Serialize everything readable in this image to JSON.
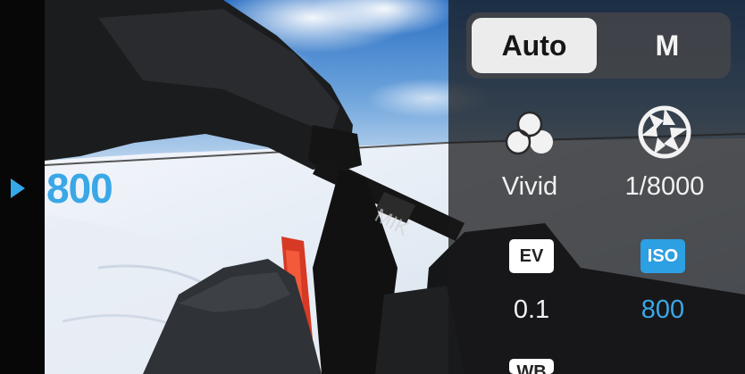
{
  "mode": {
    "auto_label": "Auto",
    "manual_label": "M",
    "selected": "Auto"
  },
  "live_view": {
    "iso_readout": "800"
  },
  "settings": {
    "color": {
      "icon": "color-profile-icon",
      "value": "Vivid"
    },
    "shutter": {
      "icon": "aperture-icon",
      "value": "1/8000"
    },
    "ev": {
      "badge": "EV",
      "value": "0.1"
    },
    "iso": {
      "badge": "ISO",
      "value": "800"
    },
    "wb": {
      "badge": "WB"
    }
  },
  "colors": {
    "accent": "#35a8ea",
    "panel_bg": "#18181a",
    "selected_mode_bg": "#ececec",
    "text_primary": "#f1f1f1"
  }
}
